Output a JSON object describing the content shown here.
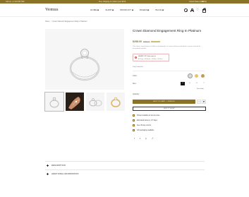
{
  "topbar": {
    "left_text": "Call us: +1 234 567 890",
    "center_text": "Free shipping on orders over $150",
    "right_text": "United States (USD $)",
    "right_extra": "EN"
  },
  "header": {
    "logo": "Vemus",
    "nav": [
      {
        "label": "HOME"
      },
      {
        "label": "SHOP"
      },
      {
        "label": "PRODUCT"
      },
      {
        "label": "PAGES"
      },
      {
        "label": "BLOG"
      }
    ],
    "cart_count": "0"
  },
  "breadcrumb": [
    "Home",
    "/",
    "Crown Diamond Engagement Ring In Platinum"
  ],
  "product": {
    "title": "Crown Diamond Engagement Ring In Platinum",
    "price": "$258.00",
    "old_price": "$288.00",
    "discount": "-10% OFF",
    "description": "This classic ring features a brilliant-cut diamond in a crown setting raised above a pavé-set band for exceptional sparkle.",
    "alert_title": "HURRY UP! Sale ends in:",
    "alert_timer": "00 Days : 00 Hours : 00 Mins : 00 Secs",
    "sold_text": "Only 5 item left",
    "color_label": "Color:",
    "colors": [
      "#d9d9d9",
      "#e8c46b",
      "#c99a4a"
    ],
    "size_label": "Size:",
    "sizes": [
      "4",
      "5",
      "6",
      "7"
    ],
    "size_guide": "Size Guide",
    "quantity_label": "Quantity:",
    "quantity": "1",
    "add_to_cart": "ADD TO CART — $258.00",
    "buy_now": "BUY IT NOW",
    "features": [
      "Pickup available at Vemus store",
      "Estimated delivery: 3-5 days",
      "Free 30-day returns",
      "Gift packaging available"
    ]
  },
  "accordion": [
    {
      "label": "DESCRIPTION"
    },
    {
      "label": "ADDITIONAL INFORMATION"
    }
  ],
  "colors": {
    "accent": "#8a7326",
    "topbar": "#8a7326",
    "badge": "#d2b04c"
  }
}
